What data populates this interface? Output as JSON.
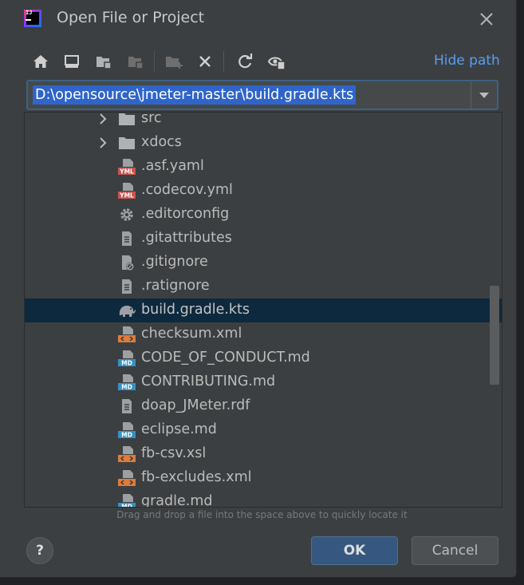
{
  "window": {
    "title": "Open File or Project",
    "app_icon": "intellij-idea-icon",
    "app_icon_text": "IJ"
  },
  "toolbar": {
    "icons": [
      "home-icon",
      "desktop-icon",
      "project-folder-icon",
      "module-folder-icon",
      "new-folder-icon",
      "delete-icon",
      "refresh-icon",
      "show-hidden-icon"
    ],
    "hide_path_label": "Hide path"
  },
  "path": {
    "value": "D:\\opensource\\jmeter-master\\build.gradle.kts"
  },
  "tree": {
    "items": [
      {
        "label": "src",
        "icon": "folder-icon",
        "expandable": true
      },
      {
        "label": "xdocs",
        "icon": "folder-icon",
        "expandable": true
      },
      {
        "label": ".asf.yaml",
        "icon": "yaml-file-icon",
        "badge": "YML"
      },
      {
        "label": ".codecov.yml",
        "icon": "yaml-file-icon",
        "badge": "YML"
      },
      {
        "label": ".editorconfig",
        "icon": "gear-icon"
      },
      {
        "label": ".gitattributes",
        "icon": "text-file-icon"
      },
      {
        "label": ".gitignore",
        "icon": "ignore-file-icon"
      },
      {
        "label": ".ratignore",
        "icon": "text-file-icon"
      },
      {
        "label": "build.gradle.kts",
        "icon": "gradle-elephant-icon",
        "selected": true
      },
      {
        "label": "checksum.xml",
        "icon": "xml-file-icon"
      },
      {
        "label": "CODE_OF_CONDUCT.md",
        "icon": "markdown-file-icon",
        "badge": "MD"
      },
      {
        "label": "CONTRIBUTING.md",
        "icon": "markdown-file-icon",
        "badge": "MD"
      },
      {
        "label": "doap_JMeter.rdf",
        "icon": "text-file-icon"
      },
      {
        "label": "eclipse.md",
        "icon": "markdown-file-icon",
        "badge": "MD"
      },
      {
        "label": "fb-csv.xsl",
        "icon": "xml-file-icon"
      },
      {
        "label": "fb-excludes.xml",
        "icon": "xml-file-icon"
      },
      {
        "label": "gradle.md",
        "icon": "markdown-file-icon",
        "badge": "MD"
      }
    ]
  },
  "hint": "Drag and drop a file into the space above to quickly locate it",
  "buttons": {
    "help": "?",
    "ok": "OK",
    "cancel": "Cancel"
  },
  "colors": {
    "background": "#3c3f41",
    "selection": "#0d293e",
    "path_highlight": "#2f65ca",
    "link": "#589df6",
    "ok_button": "#365880",
    "yaml_badge": "#c75450",
    "markdown_badge": "#3592c4",
    "xml_badge": "#e07b39"
  }
}
